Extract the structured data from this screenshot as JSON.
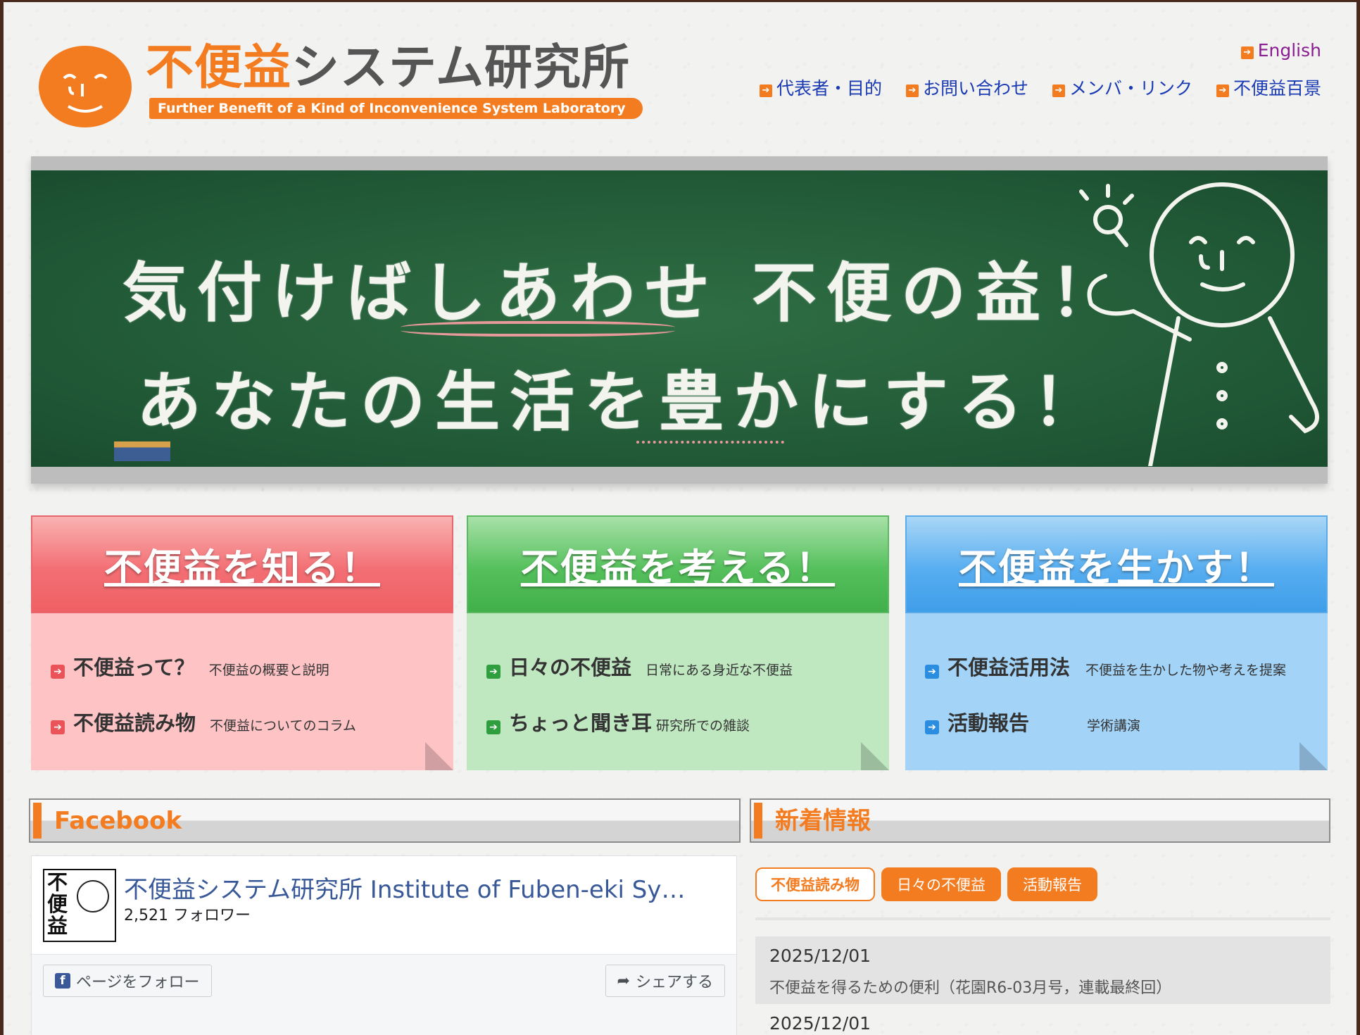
{
  "header": {
    "logo_title_highlight": "不便益",
    "logo_title_rest": "システム研究所",
    "logo_subtitle": "Further Benefit of a Kind of Inconvenience System Laboratory",
    "lang_link": "English",
    "nav": [
      {
        "label": "代表者・目的"
      },
      {
        "label": "お問い合わせ"
      },
      {
        "label": "メンバ・リンク"
      },
      {
        "label": "不便益百景"
      }
    ]
  },
  "hero": {
    "line1": "気付けばしあわせ 不便の益！",
    "line2": "あなたの生活を豊かにする！"
  },
  "panels": [
    {
      "title": "不便益を知る！",
      "items": [
        {
          "label": "不便益って？",
          "desc": "不便益の概要と説明"
        },
        {
          "label": "不便益読み物",
          "desc": "不便益についてのコラム"
        }
      ]
    },
    {
      "title": "不便益を考える！",
      "items": [
        {
          "label": "日々の不便益",
          "desc": "日常にある身近な不便益"
        },
        {
          "label": "ちょっと聞き耳",
          "desc": "研究所での雑談"
        }
      ]
    },
    {
      "title": "不便益を生かす！",
      "items": [
        {
          "label": "不便益活用法",
          "desc": "不便益を生かした物や考えを提案"
        },
        {
          "label": "活動報告",
          "desc": "学術講演"
        }
      ]
    }
  ],
  "facebook": {
    "section_title": "Facebook",
    "avatar_text": "不便益",
    "page_name": "不便益システム研究所 Institute of Fuben-eki Sy…",
    "followers": "2,521 フォロワー",
    "follow_label": "ページをフォロー",
    "share_label": "シェアする"
  },
  "news": {
    "section_title": "新着情報",
    "tabs": [
      {
        "label": "不便益読み物",
        "active": true
      },
      {
        "label": "日々の不便益",
        "active": false
      },
      {
        "label": "活動報告",
        "active": false
      }
    ],
    "items": [
      {
        "date": "2025/12/01",
        "title": "不便益を得るための便利（花園R6-03月号，連載最終回）"
      },
      {
        "date": "2025/12/01",
        "title": ""
      }
    ]
  },
  "colors": {
    "brand_orange": "#f47c20",
    "nav_blue": "#1a3ab3",
    "chalkboard_green": "#205836",
    "panel_red": "#ef6064",
    "panel_green": "#41b04a",
    "panel_blue": "#3f9ee9"
  },
  "icons": {
    "nav_bullet": "arrow-right-box-icon",
    "facebook": "facebook-logo-icon",
    "share": "share-arrow-icon"
  }
}
